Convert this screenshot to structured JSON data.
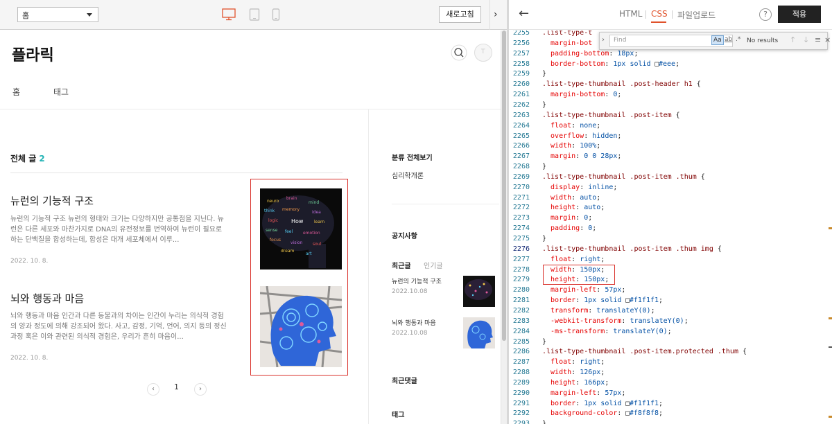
{
  "preview_toolbar": {
    "page_select": "홈",
    "refresh_label": "새로고침",
    "icons": [
      "desktop-icon",
      "tablet-icon",
      "mobile-icon"
    ]
  },
  "blog": {
    "title": "플라릭",
    "nav": [
      "홈",
      "태그"
    ],
    "all_posts_label": "전체 글",
    "all_posts_count": "2",
    "posts": [
      {
        "title": "뉴런의 기능적 구조",
        "desc": "뉴런의 기능적 구조 뉴런의 형태와 크기는 다양하지만 공통점을 지닌다. 뉴런은 다른 세포와 마찬가지로 DNA의 유전정보를 번역하여 뉴런이 필요로 하는 단백질을 합성하는데, 합성은 대개 세포체에서 이루...",
        "date": "2022. 10. 8."
      },
      {
        "title": "뇌와 행동과 마음",
        "desc": "뇌와 행동과 마음 인간과 다른 동물과의 차이는 인간이 누리는 의식적 경험의 양과 정도에 의해 강조되어 왔다. 사고, 감정, 기억, 언어, 의지 등의 정신 과정 혹은 이와 관련된 의식적 경험은, 우리가 흔히 마음이...",
        "date": "2022. 10. 8."
      }
    ],
    "pager": {
      "page": "1",
      "prev": "‹",
      "next": "›"
    },
    "sidebar": {
      "category_label": "분류 전체보기",
      "category_item": "심리학개론",
      "notice_label": "공지사항",
      "tab_recent": "최근글",
      "tab_popular": "인기글",
      "recent": [
        {
          "title": "뉴런의 기능적 구조",
          "date": "2022.10.08"
        },
        {
          "title": "뇌와 행동과 마음",
          "date": "2022.10.08"
        }
      ],
      "comments_label": "최근댓글",
      "tags_label": "태그"
    },
    "header_icon_letter": "T"
  },
  "editor": {
    "tabs": [
      "HTML",
      "CSS",
      "파일업로드"
    ],
    "active_tab": "CSS",
    "help": "?",
    "apply_label": "적용",
    "find": {
      "placeholder": "Find",
      "opt_case": "Aa",
      "opt_word": "ab",
      "opt_regex": ".*",
      "status": "No results"
    },
    "lines": [
      {
        "n": "2255",
        "t": [
          [
            ".list-type-t",
            "sel"
          ]
        ]
      },
      {
        "n": "2256",
        "t": [
          [
            "  margin-bot",
            "prop"
          ]
        ]
      },
      {
        "n": "2257",
        "t": [
          [
            "  padding-bottom",
            "prop"
          ],
          [
            ": ",
            "pn"
          ],
          [
            "18px",
            "val"
          ],
          [
            ";",
            "pn"
          ]
        ]
      },
      {
        "n": "2258",
        "t": [
          [
            "  border-bottom",
            "prop"
          ],
          [
            ": ",
            "pn"
          ],
          [
            "1px solid ",
            "val"
          ],
          [
            "■",
            "sw"
          ],
          [
            "#eee",
            "val"
          ],
          [
            ";",
            "pn"
          ]
        ]
      },
      {
        "n": "2259",
        "t": [
          [
            "}",
            "pn"
          ]
        ]
      },
      {
        "n": "2260",
        "t": [
          [
            ".list-type-thumbnail .post-header h1 ",
            "sel"
          ],
          [
            "{",
            "pn"
          ]
        ]
      },
      {
        "n": "2261",
        "t": [
          [
            "  margin-bottom",
            "prop"
          ],
          [
            ": ",
            "pn"
          ],
          [
            "0",
            "val"
          ],
          [
            ";",
            "pn"
          ]
        ]
      },
      {
        "n": "2262",
        "t": [
          [
            "}",
            "pn"
          ]
        ]
      },
      {
        "n": "2263",
        "t": [
          [
            ".list-type-thumbnail .post-item ",
            "sel"
          ],
          [
            "{",
            "pn"
          ]
        ]
      },
      {
        "n": "2264",
        "t": [
          [
            "  float",
            "prop"
          ],
          [
            ": ",
            "pn"
          ],
          [
            "none",
            "val"
          ],
          [
            ";",
            "pn"
          ]
        ]
      },
      {
        "n": "2265",
        "t": [
          [
            "  overflow",
            "prop"
          ],
          [
            ": ",
            "pn"
          ],
          [
            "hidden",
            "val"
          ],
          [
            ";",
            "pn"
          ]
        ]
      },
      {
        "n": "2266",
        "t": [
          [
            "  width",
            "prop"
          ],
          [
            ": ",
            "pn"
          ],
          [
            "100%",
            "val"
          ],
          [
            ";",
            "pn"
          ]
        ]
      },
      {
        "n": "2267",
        "t": [
          [
            "  margin",
            "prop"
          ],
          [
            ": ",
            "pn"
          ],
          [
            "0 0 28px",
            "val"
          ],
          [
            ";",
            "pn"
          ]
        ]
      },
      {
        "n": "2268",
        "t": [
          [
            "}",
            "pn"
          ]
        ]
      },
      {
        "n": "2269",
        "t": [
          [
            ".list-type-thumbnail .post-item .thum ",
            "sel"
          ],
          [
            "{",
            "pn"
          ]
        ]
      },
      {
        "n": "2270",
        "t": [
          [
            "  display",
            "prop"
          ],
          [
            ": ",
            "pn"
          ],
          [
            "inline",
            "val"
          ],
          [
            ";",
            "pn"
          ]
        ]
      },
      {
        "n": "2271",
        "t": [
          [
            "  width",
            "prop"
          ],
          [
            ": ",
            "pn"
          ],
          [
            "auto",
            "val"
          ],
          [
            ";",
            "pn"
          ]
        ]
      },
      {
        "n": "2272",
        "t": [
          [
            "  height",
            "prop"
          ],
          [
            ": ",
            "pn"
          ],
          [
            "auto",
            "val"
          ],
          [
            ";",
            "pn"
          ]
        ]
      },
      {
        "n": "2273",
        "t": [
          [
            "  margin",
            "prop"
          ],
          [
            ": ",
            "pn"
          ],
          [
            "0",
            "val"
          ],
          [
            ";",
            "pn"
          ]
        ]
      },
      {
        "n": "2274",
        "t": [
          [
            "  padding",
            "prop"
          ],
          [
            ": ",
            "pn"
          ],
          [
            "0",
            "val"
          ],
          [
            ";",
            "pn"
          ]
        ]
      },
      {
        "n": "2275",
        "t": [
          [
            "}",
            "pn"
          ]
        ]
      },
      {
        "n": "2276",
        "t": [
          [
            ".list-type-thumbnail .post-item .thum img ",
            "sel"
          ],
          [
            "{",
            "pn"
          ]
        ]
      },
      {
        "n": "2277",
        "t": [
          [
            "  float",
            "prop"
          ],
          [
            ": ",
            "pn"
          ],
          [
            "right",
            "val"
          ],
          [
            ";",
            "pn"
          ]
        ]
      },
      {
        "n": "2278",
        "t": [
          [
            "  width",
            "prop"
          ],
          [
            ": ",
            "pn"
          ],
          [
            "150px",
            "val"
          ],
          [
            ";",
            "pn"
          ]
        ]
      },
      {
        "n": "2279",
        "t": [
          [
            "  height",
            "prop"
          ],
          [
            ": ",
            "pn"
          ],
          [
            "150px",
            "val"
          ],
          [
            ";",
            "pn"
          ]
        ]
      },
      {
        "n": "2280",
        "t": [
          [
            "  margin-left",
            "prop"
          ],
          [
            ": ",
            "pn"
          ],
          [
            "57px",
            "val"
          ],
          [
            ";",
            "pn"
          ]
        ]
      },
      {
        "n": "2281",
        "t": [
          [
            "  border",
            "prop"
          ],
          [
            ": ",
            "pn"
          ],
          [
            "1px solid ",
            "val"
          ],
          [
            "■",
            "sw"
          ],
          [
            "#f1f1f1",
            "val"
          ],
          [
            ";",
            "pn"
          ]
        ]
      },
      {
        "n": "2282",
        "t": [
          [
            "  transform",
            "prop"
          ],
          [
            ": ",
            "pn"
          ],
          [
            "translateY(0)",
            "val"
          ],
          [
            ";",
            "pn"
          ]
        ]
      },
      {
        "n": "2283",
        "t": [
          [
            "  -webkit-transform",
            "prop"
          ],
          [
            ": ",
            "pn"
          ],
          [
            "translateY(0)",
            "val"
          ],
          [
            ";",
            "pn"
          ]
        ]
      },
      {
        "n": "2284",
        "t": [
          [
            "  -ms-transform",
            "prop"
          ],
          [
            ": ",
            "pn"
          ],
          [
            "translateY(0)",
            "val"
          ],
          [
            ";",
            "pn"
          ]
        ]
      },
      {
        "n": "2285",
        "t": [
          [
            "}",
            "pn"
          ]
        ]
      },
      {
        "n": "2286",
        "t": [
          [
            ".list-type-thumbnail .post-item.protected .thum ",
            "sel"
          ],
          [
            "{",
            "pn"
          ]
        ]
      },
      {
        "n": "2287",
        "t": [
          [
            "  float",
            "prop"
          ],
          [
            ": ",
            "pn"
          ],
          [
            "right",
            "val"
          ],
          [
            ";",
            "pn"
          ]
        ]
      },
      {
        "n": "2288",
        "t": [
          [
            "  width",
            "prop"
          ],
          [
            ": ",
            "pn"
          ],
          [
            "126px",
            "val"
          ],
          [
            ";",
            "pn"
          ]
        ]
      },
      {
        "n": "2289",
        "t": [
          [
            "  height",
            "prop"
          ],
          [
            ": ",
            "pn"
          ],
          [
            "166px",
            "val"
          ],
          [
            ";",
            "pn"
          ]
        ]
      },
      {
        "n": "2290",
        "t": [
          [
            "  margin-left",
            "prop"
          ],
          [
            ": ",
            "pn"
          ],
          [
            "57px",
            "val"
          ],
          [
            ";",
            "pn"
          ]
        ]
      },
      {
        "n": "2291",
        "t": [
          [
            "  border",
            "prop"
          ],
          [
            ": ",
            "pn"
          ],
          [
            "1px solid ",
            "val"
          ],
          [
            "■",
            "sw"
          ],
          [
            "#f1f1f1",
            "val"
          ],
          [
            ";",
            "pn"
          ]
        ]
      },
      {
        "n": "2292",
        "t": [
          [
            "  background-color",
            "prop"
          ],
          [
            ": ",
            "pn"
          ],
          [
            "■",
            "sw"
          ],
          [
            "#f8f8f8",
            "val"
          ],
          [
            ";",
            "pn"
          ]
        ]
      },
      {
        "n": "2293",
        "t": [
          [
            "}",
            "pn"
          ]
        ]
      }
    ],
    "current_line": "2276"
  },
  "colors": {
    "accent": "#e0522b",
    "count": "#22b3b5",
    "highlight_box": "#d9312b",
    "apply_bg": "#222222"
  }
}
